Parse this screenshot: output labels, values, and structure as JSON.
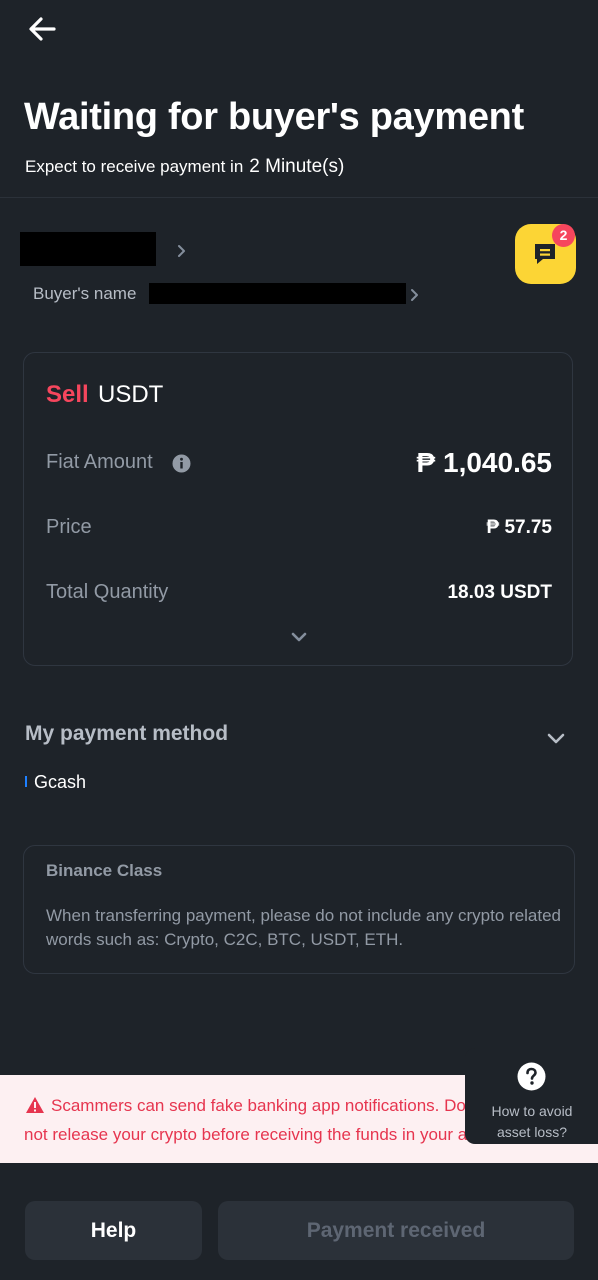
{
  "header": {
    "title": "Waiting for buyer's payment",
    "subtitle_prefix": "Expect to receive payment in",
    "subtitle_time": "2 Minute(s)"
  },
  "buyer": {
    "name_label": "Buyer's name"
  },
  "chat": {
    "unread_count": "2",
    "accent": "#fcd535",
    "badge_color": "#f6465d"
  },
  "order": {
    "side": "Sell",
    "asset": "USDT",
    "side_color": "#f6465d",
    "rows": [
      {
        "label": "Fiat Amount",
        "value": "₱ 1,040.65"
      },
      {
        "label": "Price",
        "value": "₱ 57.75"
      },
      {
        "label": "Total Quantity",
        "value": "18.03 USDT"
      }
    ]
  },
  "payment_method": {
    "title": "My payment method",
    "method": "Gcash",
    "method_color": "#1e80ff"
  },
  "binance_class": {
    "title": "Binance Class",
    "text": "When transferring payment, please do not include any crypto related words such as: Crypto, C2C, BTC, USDT, ETH."
  },
  "warning": {
    "line1": "Scammers can send fake banking app notifications. Do",
    "line2": "not release your crypto before receiving the funds in your account.",
    "color": "#e6354f"
  },
  "avoid_loss": {
    "label": "How to avoid asset loss?"
  },
  "actions": {
    "help": "Help",
    "payment_received": "Payment received"
  },
  "icons": {
    "back": "arrow-left-icon",
    "chat": "chat-bubble-icon",
    "info": "info-icon",
    "expand": "chevron-down-icon",
    "warning": "warning-triangle-icon",
    "help": "question-circle-icon"
  }
}
